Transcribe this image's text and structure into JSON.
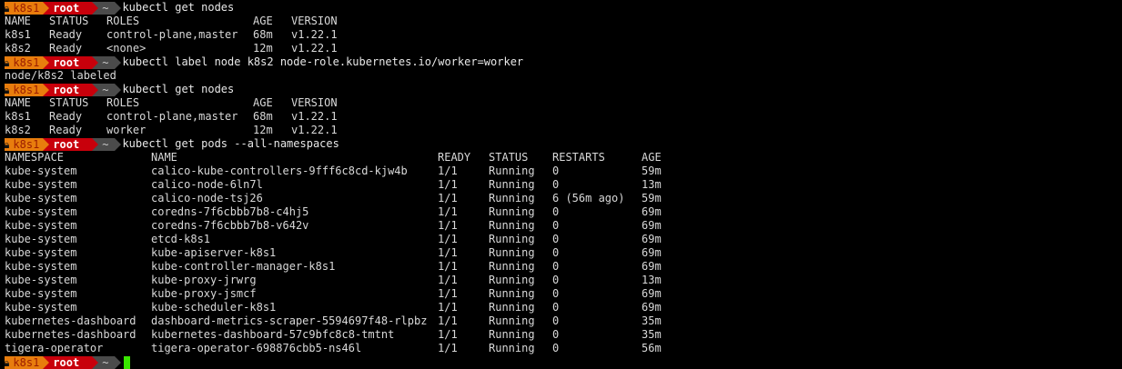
{
  "prompt": {
    "host": "k8s1",
    "user": "root",
    "dir": "~",
    "colors": {
      "host_bg": "#e87d0d",
      "user_bg": "#c8000b",
      "dir_bg": "#4b4b4b",
      "cursor": "#39e600"
    }
  },
  "commands": {
    "c1": "kubectl get nodes",
    "c2": "kubectl label node k8s2 node-role.kubernetes.io/worker=worker",
    "c3": "kubectl get nodes",
    "c4": "kubectl get pods --all-namespaces"
  },
  "label_output": "node/k8s2 labeled",
  "nodes_table_1": {
    "headers": [
      "NAME",
      "STATUS",
      "ROLES",
      "AGE",
      "VERSION"
    ],
    "rows": [
      [
        "k8s1",
        "Ready",
        "control-plane,master",
        "68m",
        "v1.22.1"
      ],
      [
        "k8s2",
        "Ready",
        "<none>",
        "12m",
        "v1.22.1"
      ]
    ]
  },
  "nodes_table_2": {
    "headers": [
      "NAME",
      "STATUS",
      "ROLES",
      "AGE",
      "VERSION"
    ],
    "rows": [
      [
        "k8s1",
        "Ready",
        "control-plane,master",
        "68m",
        "v1.22.1"
      ],
      [
        "k8s2",
        "Ready",
        "worker",
        "12m",
        "v1.22.1"
      ]
    ]
  },
  "pods_table": {
    "headers": [
      "NAMESPACE",
      "NAME",
      "READY",
      "STATUS",
      "RESTARTS",
      "AGE"
    ],
    "rows": [
      [
        "kube-system",
        "calico-kube-controllers-9fff6c8cd-kjw4b",
        "1/1",
        "Running",
        "0",
        "59m"
      ],
      [
        "kube-system",
        "calico-node-6ln7l",
        "1/1",
        "Running",
        "0",
        "13m"
      ],
      [
        "kube-system",
        "calico-node-tsj26",
        "1/1",
        "Running",
        "6 (56m ago)",
        "59m"
      ],
      [
        "kube-system",
        "coredns-7f6cbbb7b8-c4hj5",
        "1/1",
        "Running",
        "0",
        "69m"
      ],
      [
        "kube-system",
        "coredns-7f6cbbb7b8-v642v",
        "1/1",
        "Running",
        "0",
        "69m"
      ],
      [
        "kube-system",
        "etcd-k8s1",
        "1/1",
        "Running",
        "0",
        "69m"
      ],
      [
        "kube-system",
        "kube-apiserver-k8s1",
        "1/1",
        "Running",
        "0",
        "69m"
      ],
      [
        "kube-system",
        "kube-controller-manager-k8s1",
        "1/1",
        "Running",
        "0",
        "69m"
      ],
      [
        "kube-system",
        "kube-proxy-jrwrg",
        "1/1",
        "Running",
        "0",
        "13m"
      ],
      [
        "kube-system",
        "kube-proxy-jsmcf",
        "1/1",
        "Running",
        "0",
        "69m"
      ],
      [
        "kube-system",
        "kube-scheduler-k8s1",
        "1/1",
        "Running",
        "0",
        "69m"
      ],
      [
        "kubernetes-dashboard",
        "dashboard-metrics-scraper-5594697f48-rlpbz",
        "1/1",
        "Running",
        "0",
        "35m"
      ],
      [
        "kubernetes-dashboard",
        "kubernetes-dashboard-57c9bfc8c8-tmtnt",
        "1/1",
        "Running",
        "0",
        "35m"
      ],
      [
        "tigera-operator",
        "tigera-operator-698876cbb5-ns46l",
        "1/1",
        "Running",
        "0",
        "56m"
      ]
    ]
  }
}
